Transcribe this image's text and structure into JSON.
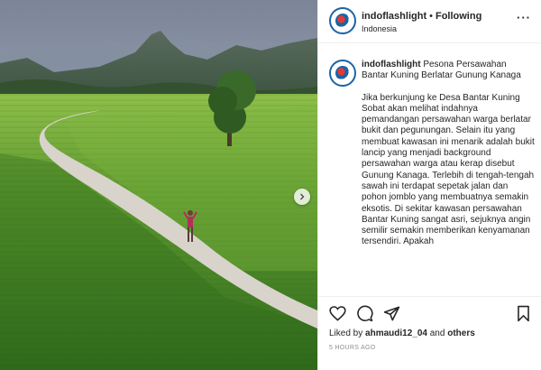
{
  "post": {
    "username": "indoflashlight",
    "follow_separator": "•",
    "follow_label": "Following",
    "location": "Indonesia",
    "more_icon": "more-options-icon",
    "caption_user": "indoflashlight",
    "caption_title": "Pesona Persawahan Bantar Kuning Berlatar Gunung Kanaga",
    "caption_body": "Jika berkunjung ke Desa Bantar Kuning Sobat akan melihat indahnya pemandangan persawahan warga berlatar bukit dan pegunungan. Selain itu yang membuat kawasan ini menarik adalah bukit lancip yang menjadi background persawahan warga atau kerap disebut Gunung Kanaga. Terlebih di tengah-tengah sawah ini terdapat sepetak jalan dan pohon jomblo yang membuatnya semakin eksotis. Di sekitar kawasan persawahan Bantar Kuning sangat asri, sejuknya angin semilir semakin memberikan kenyamanan tersendiri. Apakah",
    "likes_prefix": "Liked by",
    "likes_user": "ahmaudi12_04",
    "likes_and": "and",
    "likes_others": "others",
    "time_ago": "5 HOURS AGO"
  },
  "icons": {
    "like": "heart-icon",
    "comment": "comment-icon",
    "share": "share-icon",
    "save": "bookmark-icon",
    "next": "chevron-right-icon"
  },
  "colors": {
    "sky": "#8a96a8",
    "field": "#4f8a2b",
    "road": "#d8d4cc",
    "brand_blue": "#1b63a8"
  }
}
